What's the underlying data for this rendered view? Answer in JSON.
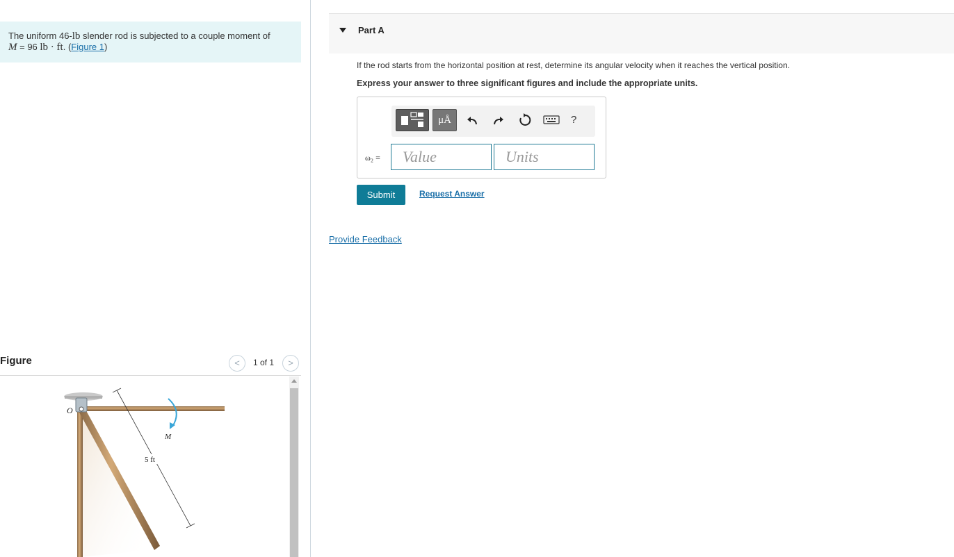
{
  "problem": {
    "intro": "The uniform 46-",
    "weight_unit": "lb",
    "mid": " slender rod is subjected to a couple moment of",
    "moment_var": "M",
    "moment_eq": " = 96 ",
    "moment_unit": "lb · ft",
    "period": ".",
    "figure_link": "Figure 1",
    "open_paren": " (",
    "close_paren": ")"
  },
  "figure": {
    "title": "Figure",
    "counter": "1 of 1",
    "prev_icon": "chevron-left-icon",
    "next_icon": "chevron-right-icon",
    "labels": {
      "pivot": "O",
      "moment": "M",
      "length": "5 ft"
    }
  },
  "part": {
    "title": "Part A",
    "question": "If the rod starts from the horizontal position at rest, determine its angular velocity when it reaches the vertical position.",
    "instruction": "Express your answer to three significant figures and include the appropriate units."
  },
  "toolbar": {
    "units_glyph": "μÅ",
    "help_glyph": "?",
    "icons": [
      "templates-icon",
      "units-icon",
      "undo-icon",
      "redo-icon",
      "reset-icon",
      "keyboard-icon",
      "help-icon"
    ]
  },
  "answer": {
    "label": "ω₂ =",
    "value_placeholder": "Value",
    "units_placeholder": "Units"
  },
  "actions": {
    "submit": "Submit",
    "request_answer": "Request Answer",
    "provide_feedback": "Provide Feedback"
  },
  "colors": {
    "accent": "#0f7c97",
    "link": "#1a6fa8",
    "problem_bg": "#e5f5f7",
    "rod": "#b8895a"
  }
}
